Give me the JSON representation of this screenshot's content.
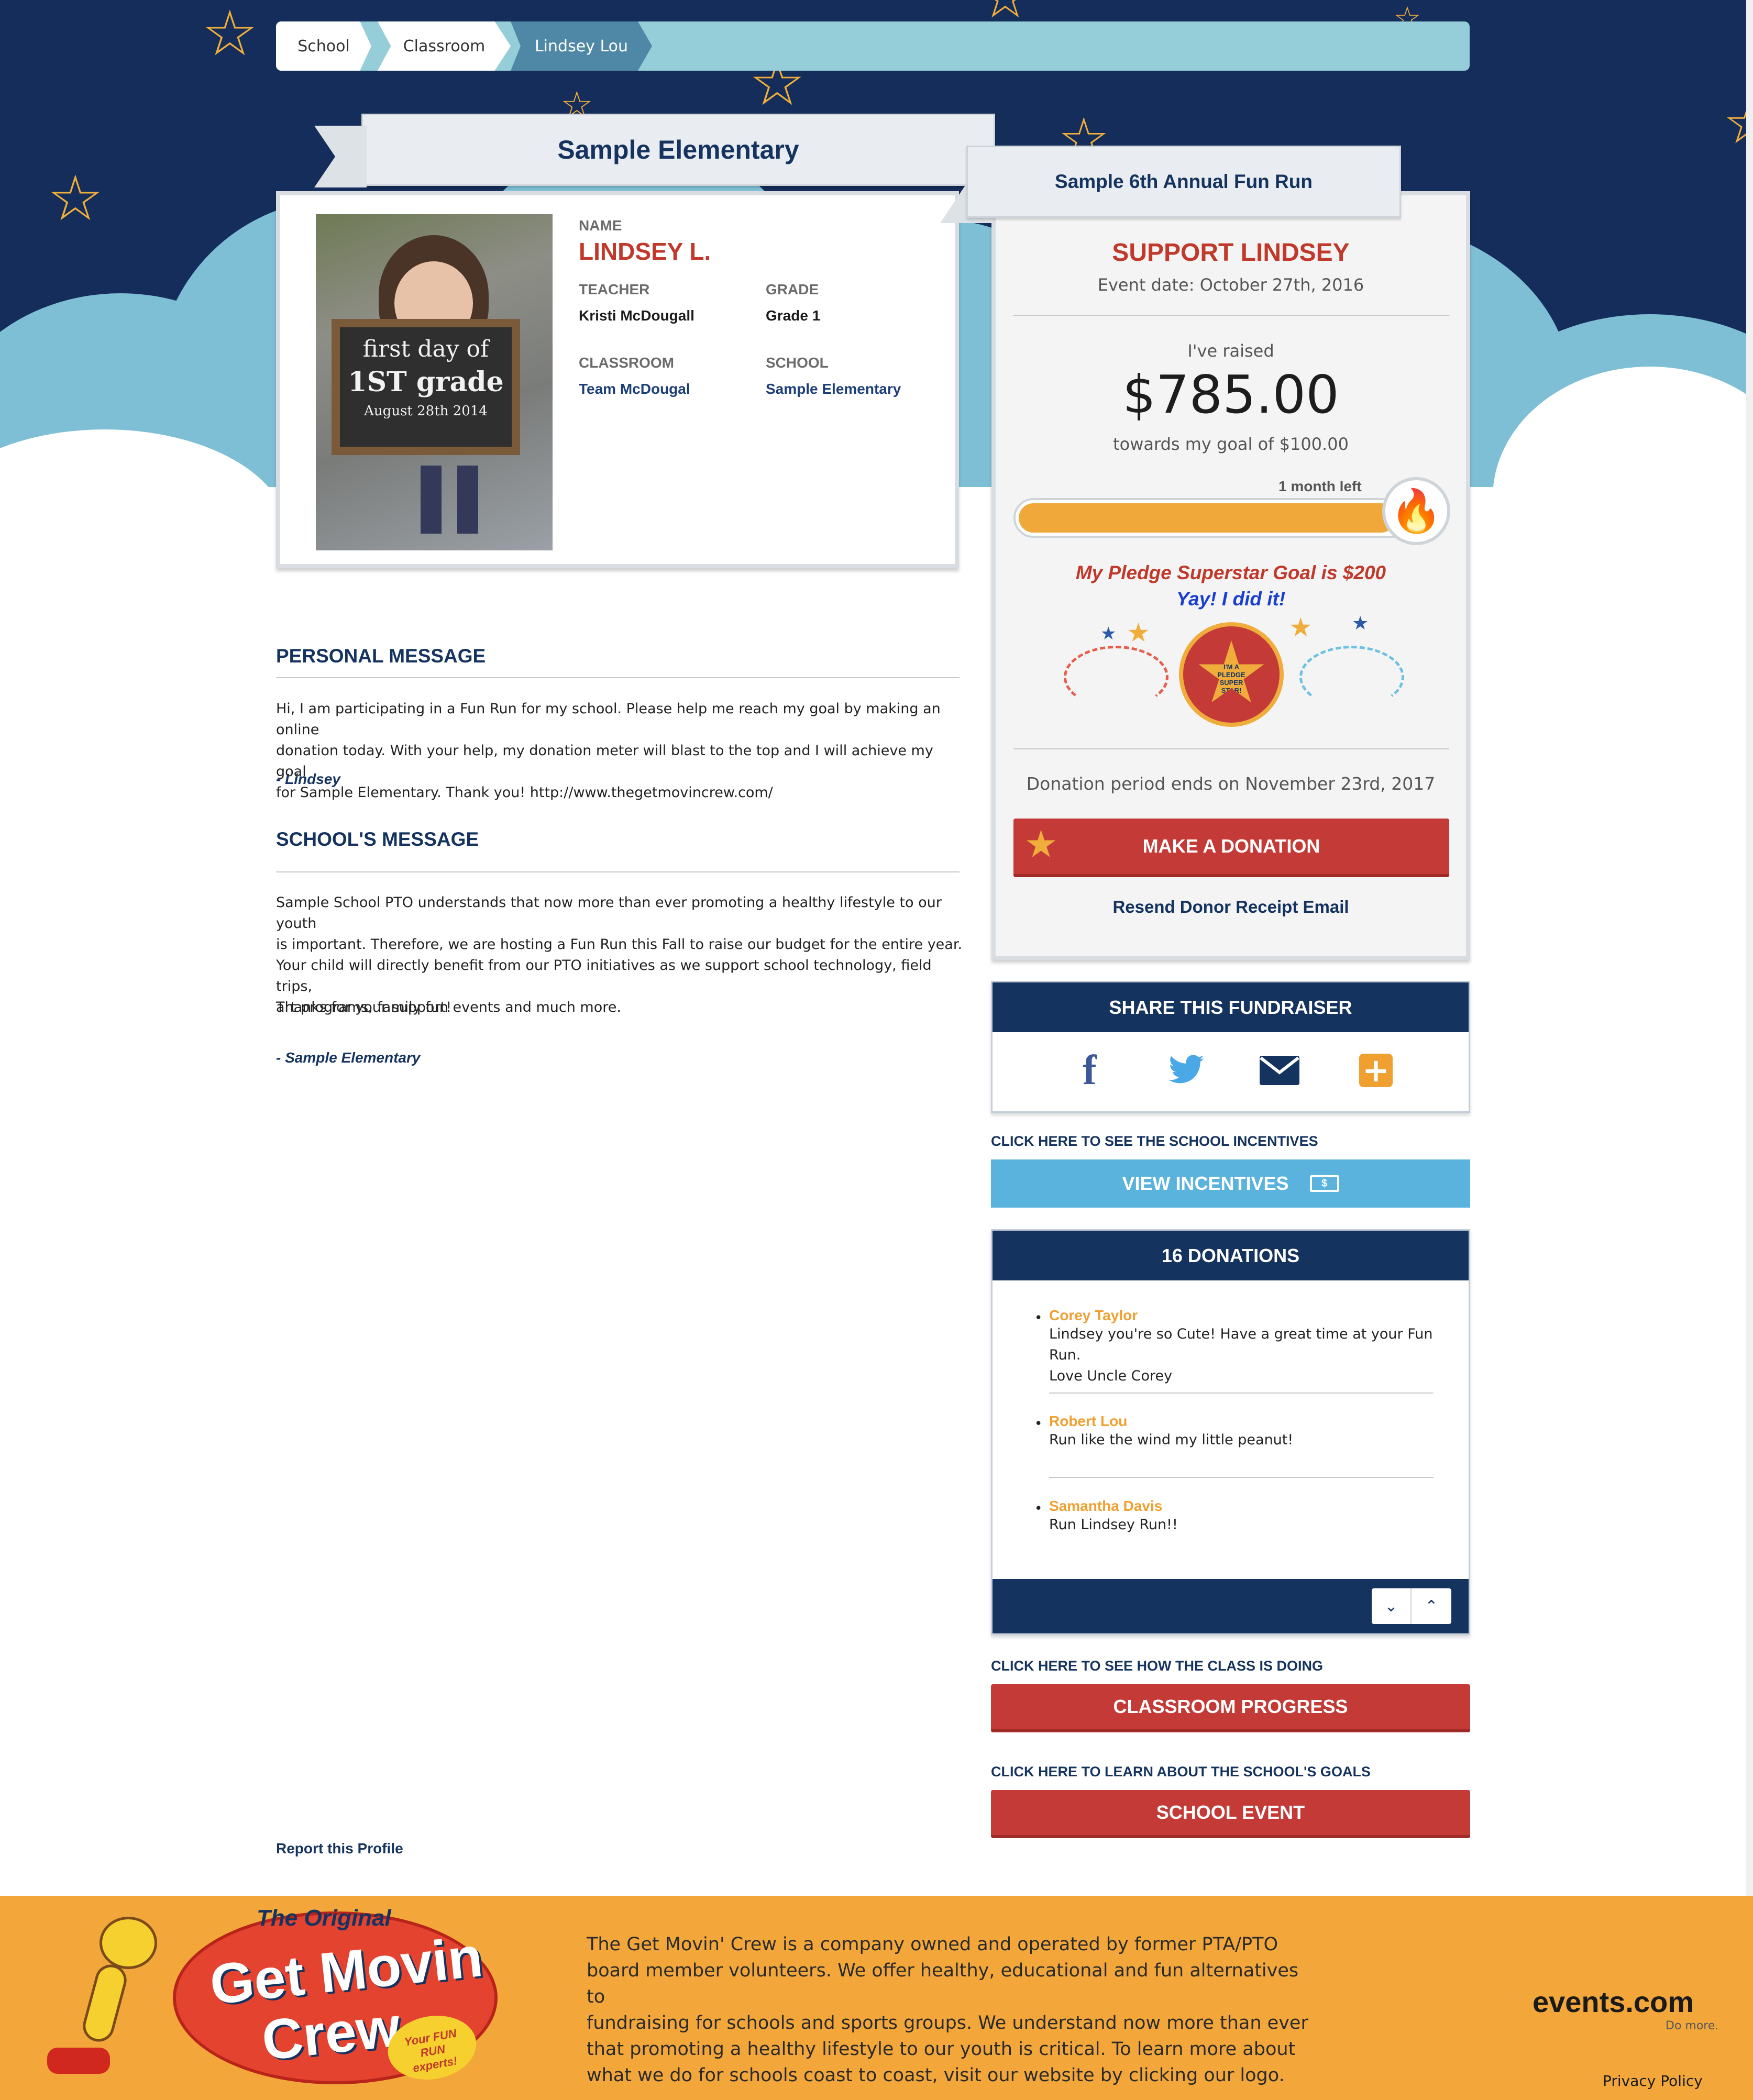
{
  "breadcrumb": [
    "School",
    "Classroom",
    "Lindsey Lou"
  ],
  "school_ribbon": "Sample Elementary",
  "event_ribbon": "Sample 6th Annual Fun Run",
  "profile": {
    "photo_sign_line1": "first day of",
    "photo_sign_line2": "1ST grade",
    "photo_sign_line3": "August 28th 2014",
    "name_label": "NAME",
    "name": "LINDSEY L.",
    "teacher_label": "TEACHER",
    "teacher": "Kristi McDougall",
    "grade_label": "GRADE",
    "grade": "Grade 1",
    "classroom_label": "CLASSROOM",
    "classroom": "Team McDougal",
    "school_label": "SCHOOL",
    "school": "Sample Elementary"
  },
  "personal": {
    "heading": "PERSONAL MESSAGE",
    "lines": [
      "Hi, I am participating in a Fun Run for my school. Please help me reach my goal by making an online",
      "donation today. With your help, my donation meter will blast to the top and I will achieve my goal",
      "for Sample Elementary. Thank you! http://www.thegetmovincrew.com/"
    ],
    "signature": "- Lindsey"
  },
  "school_msg": {
    "heading": "SCHOOL'S MESSAGE",
    "lines": [
      "Sample School PTO understands that now more than ever promoting a healthy lifestyle to our youth",
      "is important. Therefore, we are hosting a Fun Run this Fall to raise our budget for the entire year.",
      "Your child will directly benefit from our PTO initiatives as we support school technology, field trips,",
      "art programs, family fun events and much more."
    ],
    "thanks": "Thanks for your support!",
    "signature": "- Sample Elementary"
  },
  "report_link": "Report this Profile",
  "support": {
    "title": "SUPPORT LINDSEY",
    "event_date": "Event date: October 27th, 2016",
    "raised_label": "I've raised",
    "amount": "$785.00",
    "goal": "towards my goal of $100.00",
    "time_left": "1 month left",
    "progress_fraction": 1.0,
    "superstar_goal": "My Pledge Superstar Goal is $200",
    "did_it": "Yay! I did it!",
    "badge_text": "I'M A PLEDGE SUPER STAR!",
    "period_ends": "Donation period ends on November 23rd, 2017",
    "donate_button": "MAKE A DONATION",
    "resend": "Resend Donor Receipt Email"
  },
  "share": {
    "title": "SHARE THIS FUNDRAISER",
    "icons": [
      "facebook-icon",
      "twitter-icon",
      "email-icon",
      "plus-icon"
    ]
  },
  "incentives": {
    "caption": "CLICK HERE TO SEE THE SCHOOL INCENTIVES",
    "button": "VIEW INCENTIVES"
  },
  "donations": {
    "title": "16 DONATIONS",
    "items": [
      {
        "name": "Corey Taylor",
        "lines": [
          "Lindsey you're so Cute! Have a great time at your Fun Run.",
          "Love Uncle Corey"
        ]
      },
      {
        "name": "Robert Lou",
        "lines": [
          "Run like the wind my little peanut!"
        ]
      },
      {
        "name": "Samantha Davis",
        "lines": [
          "Run Lindsey Run!!"
        ]
      }
    ]
  },
  "classroom": {
    "caption": "CLICK HERE TO SEE HOW THE CLASS IS DOING",
    "button": "CLASSROOM PROGRESS"
  },
  "school_event": {
    "caption": "CLICK HERE TO LEARN ABOUT THE SCHOOL'S GOALS",
    "button": "SCHOOL EVENT"
  },
  "footer": {
    "logo_top": "The Original",
    "logo_main1": "Get Movin",
    "logo_main2": "Crew",
    "logo_badge": "Your FUN RUN experts!",
    "about_lines": [
      "The Get Movin' Crew is a company owned and operated by former PTA/PTO",
      "board member volunteers. We offer healthy, educational and fun alternatives to",
      "fundraising for schools and sports groups. We understand now more than ever",
      "that promoting a healthy lifestyle to our youth is critical. To learn more about",
      "what we do for schools coast to coast, visit our website by clicking our logo."
    ],
    "brand": "events.com",
    "brand_tag": "Do more.",
    "privacy": "Privacy Policy"
  },
  "colors": {
    "navy": "#142d5a",
    "red": "#c33a36",
    "orange": "#f3a73b",
    "light_blue": "#95ced9"
  }
}
